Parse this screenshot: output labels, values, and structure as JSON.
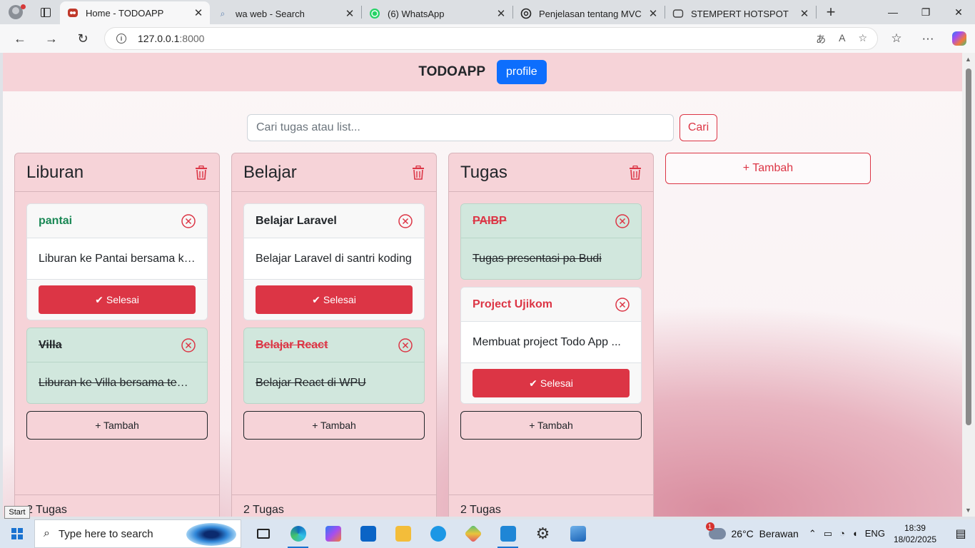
{
  "browser": {
    "tabs": [
      {
        "title": "Home - TODOAPP",
        "icon": "todoapp-favicon-icon",
        "active": true
      },
      {
        "title": "wa web - Search",
        "icon": "search-favicon-icon",
        "active": false
      },
      {
        "title": "(6) WhatsApp",
        "icon": "whatsapp-icon",
        "active": false
      },
      {
        "title": "Penjelasan tentang MVC",
        "icon": "chatgpt-icon",
        "active": false
      },
      {
        "title": "STEMPERT HOTSPOT",
        "icon": "page-icon",
        "active": false
      }
    ],
    "url_host": "127.0.0.1",
    "url_port": ":8000"
  },
  "app": {
    "brand": "TODOAPP",
    "profile_label": "profile",
    "search_placeholder": "Cari tugas atau list...",
    "search_button": "Cari",
    "add_list_label": "+ Tambah",
    "done_label": "Selesai",
    "add_task_label": "+ Tambah",
    "lists": [
      {
        "name": "Liburan",
        "count_text": "2 Tugas",
        "tasks": [
          {
            "title": "pantai",
            "desc": "Liburan ke Pantai bersama ke...",
            "done": false
          },
          {
            "title": "Villa",
            "desc": "Liburan ke Villa bersama tem...",
            "done": true
          }
        ]
      },
      {
        "name": "Belajar",
        "count_text": "2 Tugas",
        "tasks": [
          {
            "title": "Belajar Laravel",
            "desc": "Belajar Laravel di santri koding",
            "done": false
          },
          {
            "title": "Belajar React",
            "desc": "Belajar React di WPU",
            "done": true
          }
        ]
      },
      {
        "name": "Tugas",
        "count_text": "2 Tugas",
        "tasks": [
          {
            "title": "PAIBP",
            "desc": "Tugas presentasi pa Budi",
            "done": true
          },
          {
            "title": "Project Ujikom",
            "desc": "Membuat project Todo App ...",
            "done": false
          }
        ]
      }
    ],
    "colors": {
      "danger": "#dc3545",
      "primary": "#0d6efd",
      "success_bg": "#d1e7dd",
      "list_bg": "#f6d3d8",
      "green_title": "#198754"
    }
  },
  "tooltip": "Start",
  "taskbar": {
    "search_placeholder": "Type here to search",
    "weather": "26°C  Berawan",
    "weather_badge": "1",
    "lang": "ENG",
    "time": "18:39",
    "date": "18/02/2025"
  }
}
